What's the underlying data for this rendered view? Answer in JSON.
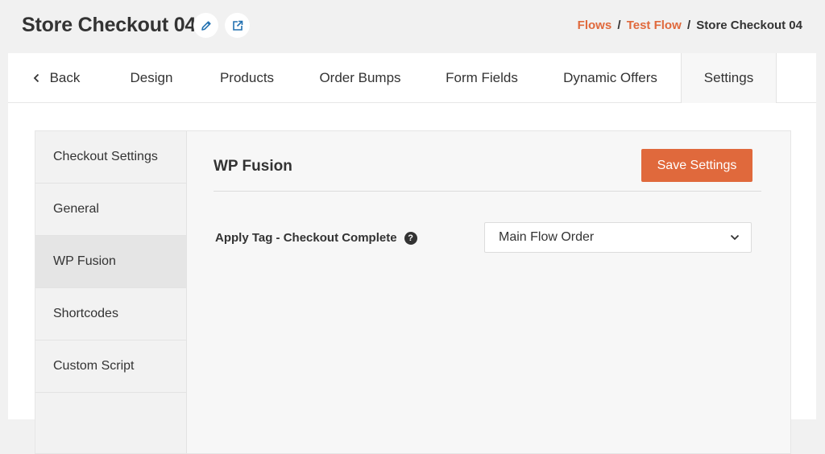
{
  "header": {
    "title": "Store Checkout 04",
    "breadcrumb": {
      "flows": "Flows",
      "test_flow": "Test Flow",
      "current": "Store Checkout 04",
      "separator": "/"
    }
  },
  "tabs": {
    "back": "Back",
    "items": [
      "Design",
      "Products",
      "Order Bumps",
      "Form Fields",
      "Dynamic Offers",
      "Settings"
    ],
    "active": "Settings"
  },
  "sidebar": {
    "items": [
      "Checkout Settings",
      "General",
      "WP Fusion",
      "Shortcodes",
      "Custom Script"
    ],
    "active": "WP Fusion"
  },
  "main": {
    "section_title": "WP Fusion",
    "save_label": "Save Settings",
    "field_label": "Apply Tag - Checkout Complete",
    "help_glyph": "?",
    "select_value": "Main Flow Order"
  },
  "colors": {
    "accent": "#e0693c",
    "active_nav_bg": "#e5e5e5"
  },
  "icons": [
    "pencil-icon",
    "external-link-icon",
    "chevron-left-icon",
    "chevron-down-icon",
    "question-circle-icon"
  ]
}
